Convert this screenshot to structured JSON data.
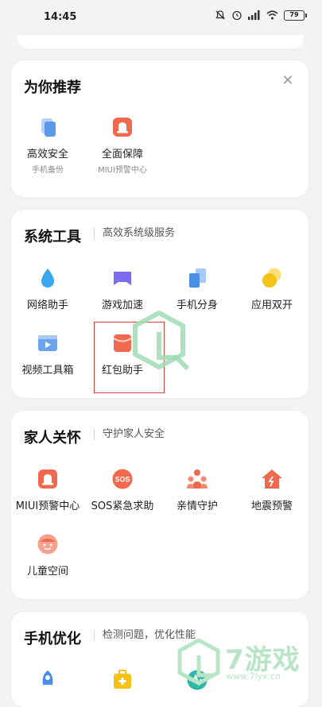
{
  "status_bar": {
    "time": "14:45",
    "battery": "79"
  },
  "recommend": {
    "title": "为你推荐",
    "items": [
      {
        "label": "高效安全",
        "sub": "手机备份",
        "icon": "phone-backup-icon"
      },
      {
        "label": "全面保障",
        "sub": "MIUI预警中心",
        "icon": "alert-center-icon"
      }
    ]
  },
  "system_tools": {
    "title": "系统工具",
    "subtitle": "高效系统级服务",
    "items": [
      {
        "label": "网络助手",
        "icon": "network-drop-icon"
      },
      {
        "label": "游戏加速",
        "icon": "gamepad-icon"
      },
      {
        "label": "手机分身",
        "icon": "dual-space-icon"
      },
      {
        "label": "应用双开",
        "icon": "dual-apps-icon"
      },
      {
        "label": "视频工具箱",
        "icon": "video-toolbox-icon"
      },
      {
        "label": "红包助手",
        "icon": "red-envelope-icon"
      }
    ]
  },
  "family_care": {
    "title": "家人关怀",
    "subtitle": "守护家人安全",
    "items": [
      {
        "label": "MIUI预警中心",
        "icon": "alert-center-icon"
      },
      {
        "label": "SOS紧急求助",
        "icon": "sos-icon"
      },
      {
        "label": "亲情守护",
        "icon": "family-guard-icon"
      },
      {
        "label": "地震预警",
        "icon": "earthquake-icon"
      },
      {
        "label": "儿童空间",
        "icon": "kids-space-icon"
      }
    ]
  },
  "phone_optimize": {
    "title": "手机优化",
    "subtitle": "检测问题，优化性能"
  },
  "watermark": {
    "text": "7游戏",
    "url": "www.7lyx.cn"
  },
  "colors": {
    "accent_red": "#f0684e",
    "highlight_border": "#d8443b",
    "blue": "#4a8fe6",
    "purple": "#7b6cf0",
    "yellow": "#f5c21a"
  }
}
